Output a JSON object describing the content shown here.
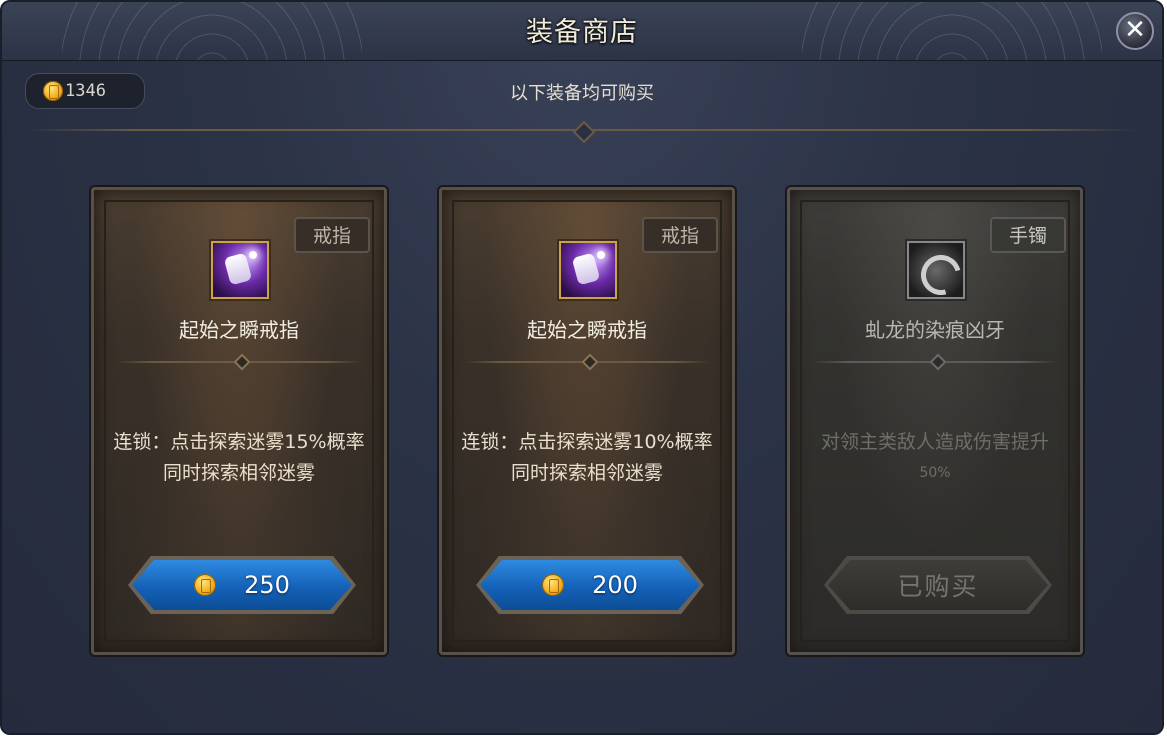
{
  "window": {
    "title": "装备商店",
    "close_label": "✕"
  },
  "currency": {
    "amount": "1346"
  },
  "subtitle": "以下装备均可购买",
  "items": [
    {
      "tag": "戒指",
      "icon": "purple-ring-icon",
      "name": "起始之瞬戒指",
      "desc_line1": "连锁：点击探索迷雾15%概率",
      "desc_line2": "同时探索相邻迷雾",
      "price": "250",
      "status": "available"
    },
    {
      "tag": "戒指",
      "icon": "purple-ring-icon",
      "name": "起始之瞬戒指",
      "desc_line1": "连锁：点击探索迷雾10%概率",
      "desc_line2": "同时探索相邻迷雾",
      "price": "200",
      "status": "available"
    },
    {
      "tag": "手镯",
      "icon": "fang-bracelet-icon",
      "name": "虬龙的染痕凶牙",
      "desc_line1": "对领主类敌人造成伤害提升",
      "desc_line2": "50%",
      "sold_label": "已购买",
      "status": "sold"
    }
  ],
  "colors": {
    "button_blue": "#1f6fc8",
    "gold": "#f2a812",
    "card_brown": "#3a3129"
  }
}
